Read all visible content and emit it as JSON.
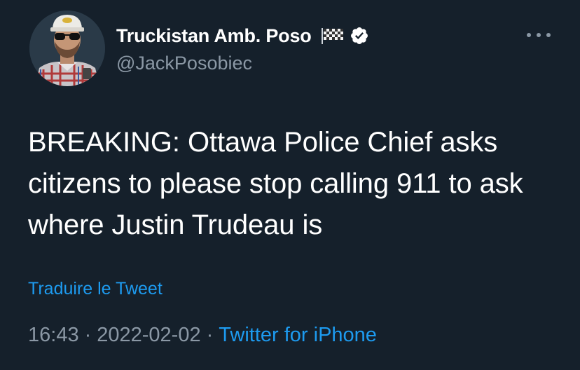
{
  "author": {
    "display_name": "Truckistan Amb. Poso",
    "handle": "@JackPosobiec",
    "name_emoji_icon": "checkered-flag-icon",
    "verified_icon": "verified-badge-icon"
  },
  "tweet": {
    "text": "BREAKING: Ottawa Police Chief asks citizens to please stop calling 911 to ask where Justin Trudeau is",
    "translate_label": "Traduire le Tweet"
  },
  "meta": {
    "time": "16:43",
    "separator": "·",
    "date": "2022-02-02",
    "source": "Twitter for iPhone"
  },
  "colors": {
    "background": "#15202b",
    "text": "#ffffff",
    "secondary": "#8b98a5",
    "link": "#1d9bf0"
  }
}
